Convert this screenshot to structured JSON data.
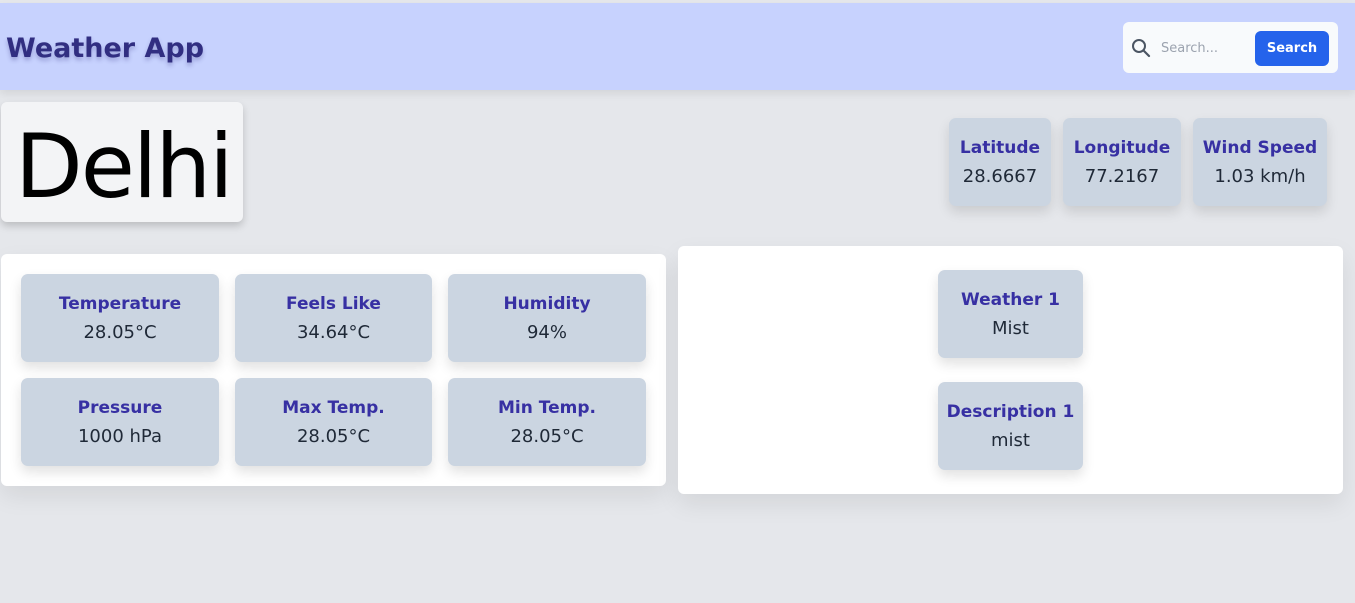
{
  "header": {
    "title": "Weather App",
    "search": {
      "placeholder": "Search...",
      "value": "",
      "button_label": "Search"
    }
  },
  "city": {
    "name": "Delhi"
  },
  "coords": {
    "latitude": {
      "label": "Latitude",
      "value": "28.6667"
    },
    "longitude": {
      "label": "Longitude",
      "value": "77.2167"
    },
    "wind": {
      "label": "Wind Speed",
      "value": "1.03 km/h"
    }
  },
  "metrics": {
    "temperature": {
      "label": "Temperature",
      "value": "28.05°C"
    },
    "feels_like": {
      "label": "Feels Like",
      "value": "34.64°C"
    },
    "humidity": {
      "label": "Humidity",
      "value": "94%"
    },
    "pressure": {
      "label": "Pressure",
      "value": "1000 hPa"
    },
    "max_temp": {
      "label": "Max Temp.",
      "value": "28.05°C"
    },
    "min_temp": {
      "label": "Min Temp.",
      "value": "28.05°C"
    }
  },
  "weather": {
    "main": {
      "label": "Weather 1",
      "value": "Mist"
    },
    "description": {
      "label": "Description 1",
      "value": "mist"
    }
  },
  "colors": {
    "header_bg": "#c7d2fe",
    "title": "#312e81",
    "card_bg": "#cbd5e1",
    "label": "#3730a3",
    "button": "#2563eb",
    "page_bg": "#e5e7eb"
  }
}
